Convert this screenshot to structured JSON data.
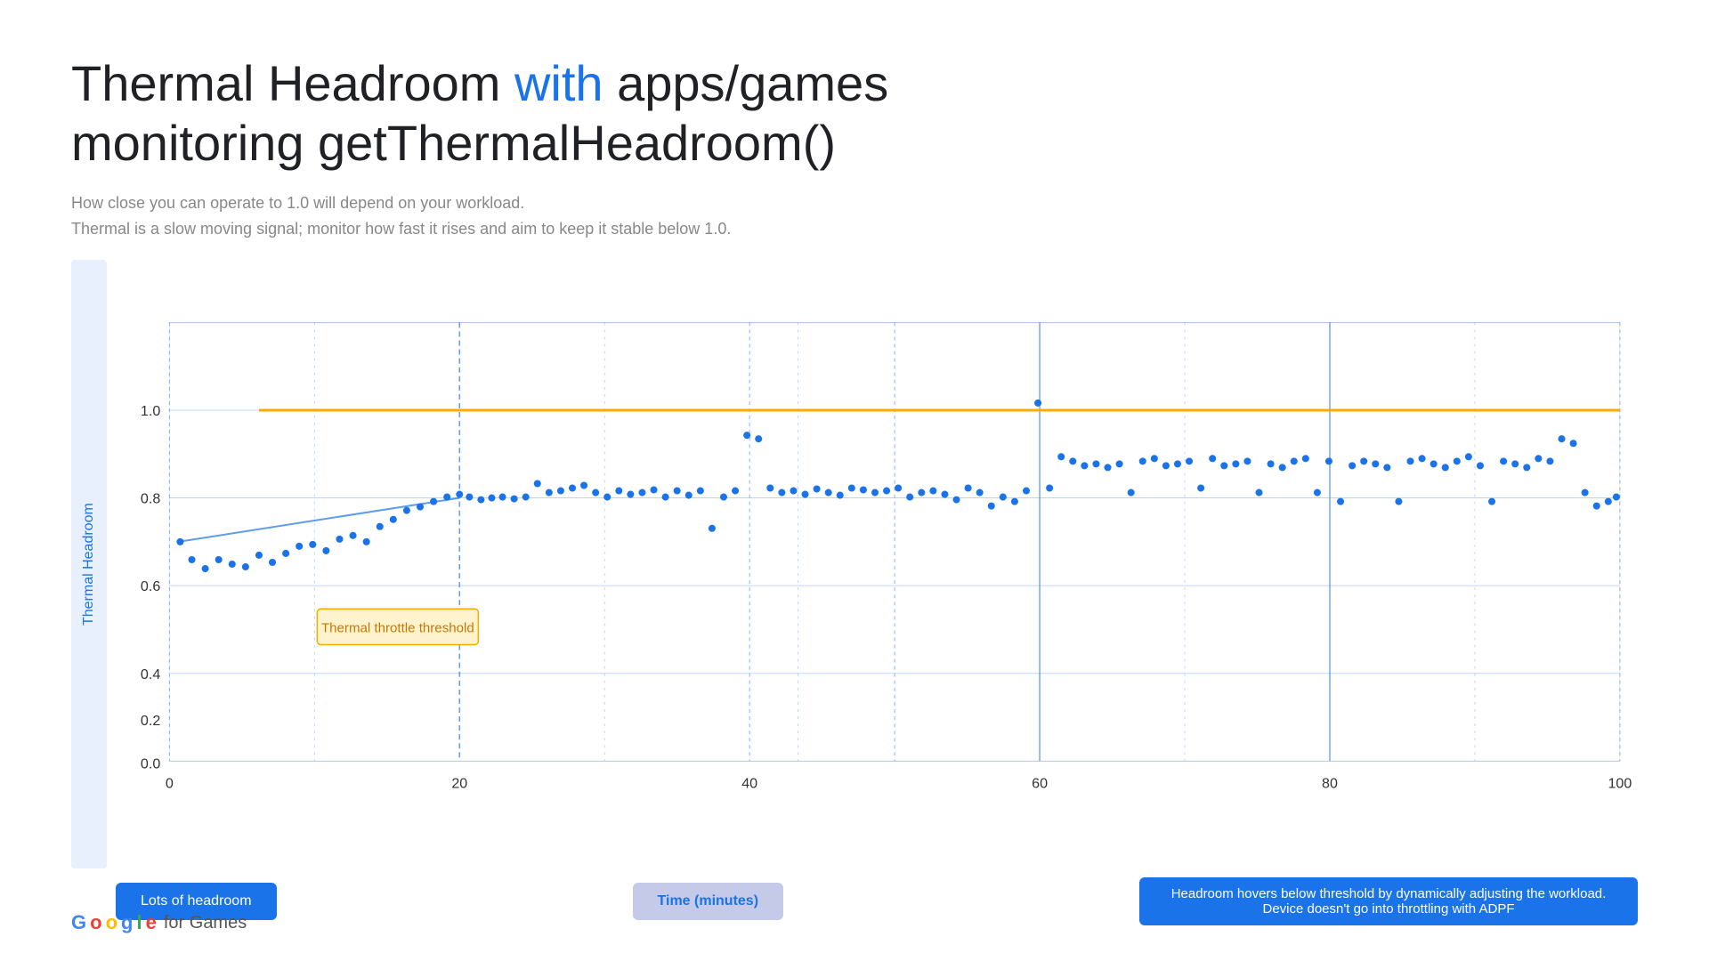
{
  "title": {
    "part1": "Thermal Headroom ",
    "highlight": "with",
    "part2": " apps/games",
    "line2": "monitoring getThermalHeadroom()"
  },
  "subtitle": {
    "line1": "How close you can operate to 1.0 will depend on your workload.",
    "line2": "Thermal is a slow moving signal; monitor how fast it rises and aim to keep it stable below 1.0."
  },
  "chart": {
    "y_axis_label": "Thermal Headroom",
    "x_axis_label": "Time (minutes)",
    "threshold_label": "Thermal throttle threshold",
    "y_ticks": [
      "0.0",
      "0.2",
      "0.4",
      "0.6",
      "0.8",
      "1.0"
    ],
    "x_ticks": [
      "0",
      "20",
      "40",
      "60",
      "80",
      "100"
    ]
  },
  "bottom_labels": {
    "lots_headroom": "Lots of headroom",
    "time_minutes": "Time (minutes)",
    "adpf_description": "Headroom hovers below threshold by dynamically adjusting the workload. Device doesn't go into throttling with ADPF"
  },
  "google_logo": {
    "text": "Google for Games"
  }
}
